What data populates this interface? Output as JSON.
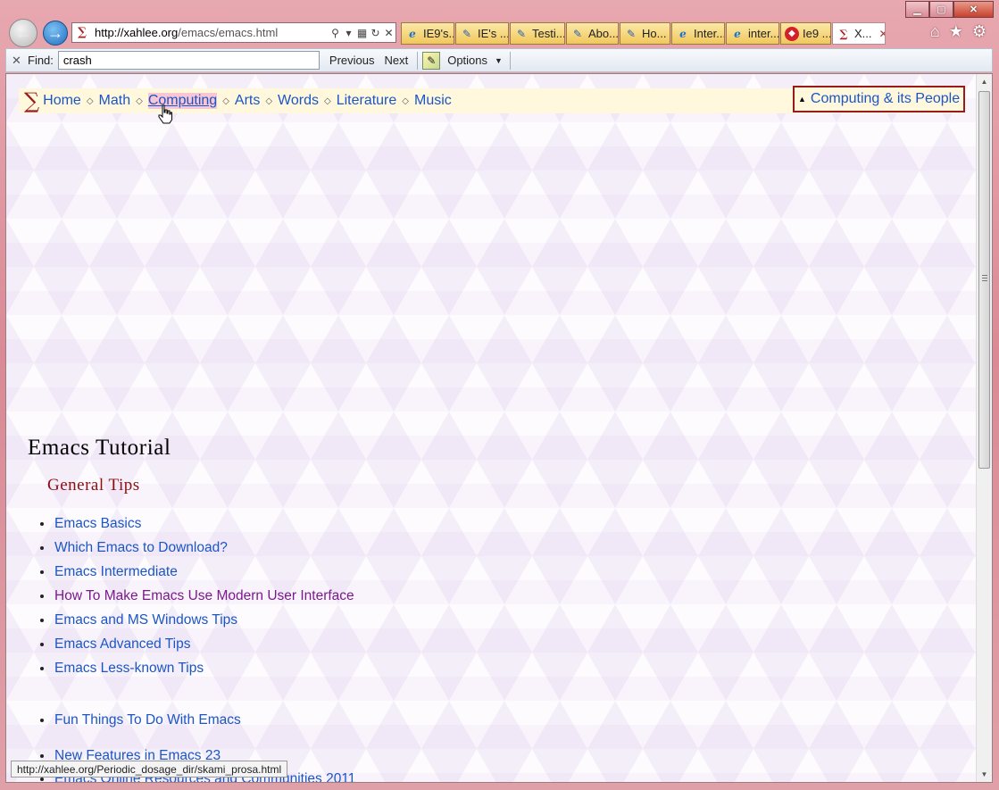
{
  "window": {
    "controls": {
      "minimize": "▁",
      "maximize": "▢",
      "close": "✕"
    }
  },
  "toolbar": {
    "back_icon": "←",
    "forward_icon": "→",
    "address": {
      "favicon": "∑",
      "url_host": "http://xahlee.org",
      "url_path": "/emacs/emacs.html",
      "search_icon": "⚲",
      "dropdown_icon": "▾",
      "compat_icon": "▦",
      "refresh_icon": "↻",
      "stop_icon": "✕"
    },
    "tabs": [
      {
        "icon": "e",
        "icon_kind": "ie",
        "label": "IE9's..."
      },
      {
        "icon": "✎",
        "icon_kind": "pen",
        "label": "IE's ..."
      },
      {
        "icon": "✎",
        "icon_kind": "pen",
        "label": "Testi..."
      },
      {
        "icon": "✎",
        "icon_kind": "pen",
        "label": "Abo..."
      },
      {
        "icon": "✎",
        "icon_kind": "pen",
        "label": "Ho..."
      },
      {
        "icon": "e",
        "icon_kind": "ie",
        "label": "Inter..."
      },
      {
        "icon": "e",
        "icon_kind": "ie",
        "label": "inter..."
      },
      {
        "icon": "◆",
        "icon_kind": "red",
        "label": "Ie9 ..."
      },
      {
        "icon": "∑",
        "icon_kind": "sigma",
        "label": "X...",
        "active": true,
        "close": "✕"
      }
    ],
    "home_icon": "⌂",
    "favorites_icon": "★",
    "tools_icon": "⚙"
  },
  "findbar": {
    "close_icon": "✕",
    "label": "Find:",
    "value": "crash",
    "previous": "Previous",
    "next": "Next",
    "options": "Options",
    "options_caret": "▼",
    "highlight_icon": "✎"
  },
  "page": {
    "logo": "∑",
    "nav": [
      {
        "label": "Home"
      },
      {
        "label": "Math"
      },
      {
        "label": "Computing",
        "hover": true
      },
      {
        "label": "Arts"
      },
      {
        "label": "Words"
      },
      {
        "label": "Literature"
      },
      {
        "label": "Music"
      }
    ],
    "nav_separator": "◇",
    "people_box": {
      "triangle": "▲",
      "label": "Computing & its People"
    },
    "title": "Emacs Tutorial",
    "section_title": "General Tips",
    "tips": [
      {
        "label": "Emacs Basics"
      },
      {
        "label": "Which Emacs to Download?"
      },
      {
        "label": "Emacs Intermediate"
      },
      {
        "label": "How To Make Emacs Use Modern User Interface",
        "visited": true
      },
      {
        "label": "Emacs and MS Windows Tips"
      },
      {
        "label": "Emacs Advanced Tips"
      },
      {
        "label": "Emacs Less-known Tips"
      }
    ],
    "extra": [
      "Fun Things To Do With Emacs",
      "New Features in Emacs 23",
      "Emacs Online Resources and Communities 2011"
    ]
  },
  "scrollbar": {
    "up": "▲",
    "down": "▼"
  },
  "status": {
    "url": "http://xahlee.org/Periodic_dosage_dir/skami_prosa.html"
  }
}
